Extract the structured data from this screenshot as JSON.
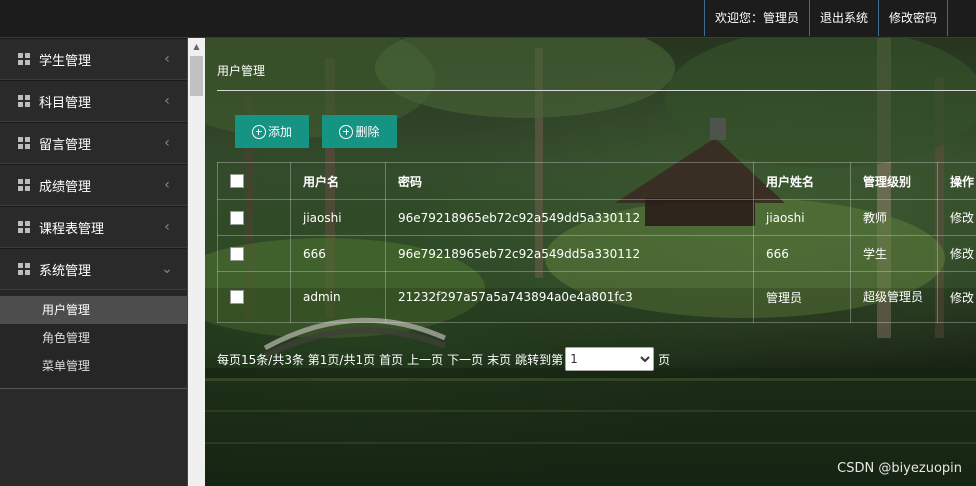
{
  "header": {
    "welcome": "欢迎您：管理员",
    "logout": "退出系统",
    "change_password": "修改密码"
  },
  "sidebar": {
    "items": [
      {
        "label": "学生管理",
        "icon": "grid-icon",
        "expanded": false
      },
      {
        "label": "科目管理",
        "icon": "grid-icon",
        "expanded": false
      },
      {
        "label": "留言管理",
        "icon": "grid-icon",
        "expanded": false
      },
      {
        "label": "成绩管理",
        "icon": "grid-icon",
        "expanded": false
      },
      {
        "label": "课程表管理",
        "icon": "grid-icon",
        "expanded": false
      },
      {
        "label": "系统管理",
        "icon": "grid-icon",
        "expanded": true
      }
    ],
    "submenu": [
      {
        "label": "用户管理",
        "active": true
      },
      {
        "label": "角色管理",
        "active": false
      },
      {
        "label": "菜单管理",
        "active": false
      }
    ],
    "chevron_collapsed": "‹",
    "chevron_expanded": "⌄"
  },
  "main": {
    "page_title": "用户管理",
    "add_label": "添加",
    "delete_label": "删除",
    "table": {
      "headers": [
        "用户名",
        "密码",
        "用户姓名",
        "管理级别",
        "操作"
      ],
      "rows": [
        {
          "username": "jiaoshi",
          "password": "96e79218965eb72c92a549dd5a330112",
          "name": "jiaoshi",
          "level": "教师",
          "action": "修改"
        },
        {
          "username": "666",
          "password": "96e79218965eb72c92a549dd5a330112",
          "name": "666",
          "level": "学生",
          "action": "修改"
        },
        {
          "username": "admin",
          "password": "21232f297a57a5a743894a0e4a801fc3",
          "name": "管理员",
          "level": "超级管理员",
          "action": "修改"
        }
      ]
    },
    "pager": {
      "summary": "每页15条/共3条 第1页/共1页",
      "first": "首页",
      "prev": "上一页",
      "next": "下一页",
      "last": "末页",
      "jump_to": "跳转到第",
      "page_value": "1",
      "page_suffix": "页"
    }
  },
  "watermark": "CSDN @biyezuopin"
}
